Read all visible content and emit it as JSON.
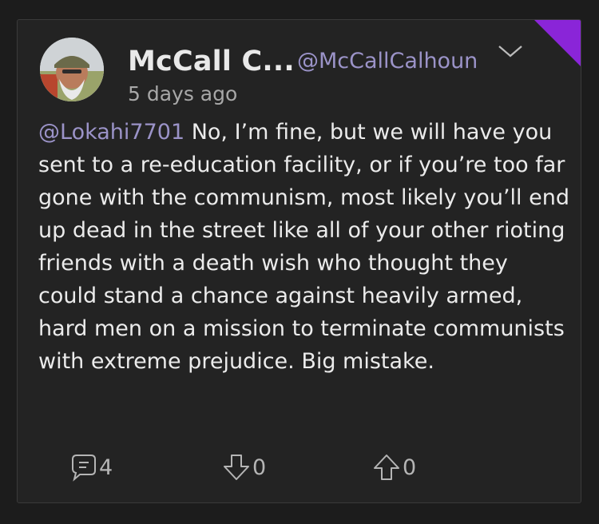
{
  "post": {
    "author_name": "McCall C...",
    "author_handle": "@McCallCalhoun",
    "timestamp": "5 days ago",
    "mention": "@Lokahi7701",
    "body": " No, I’m fine, but we will have you sent to a re-education facility, or if you’re too far gone with the communism, most likely you’ll end up dead in the street like all of your other rioting friends with a death wish who thought they could stand a chance against heavily armed, hard men on a mission to terminate communists with extreme prejudice. Big mistake.",
    "reply_count": "4",
    "downvote_count": "0",
    "upvote_count": "0"
  },
  "colors": {
    "background": "#1c1c1c",
    "card": "#232323",
    "accent_flag": "#8a25d8",
    "handle": "#9b93c8",
    "text": "#ebebeb"
  },
  "icons": {
    "menu": "chevron-down-icon",
    "reply": "comment-icon",
    "downvote": "arrow-down-icon",
    "upvote": "arrow-up-icon"
  }
}
